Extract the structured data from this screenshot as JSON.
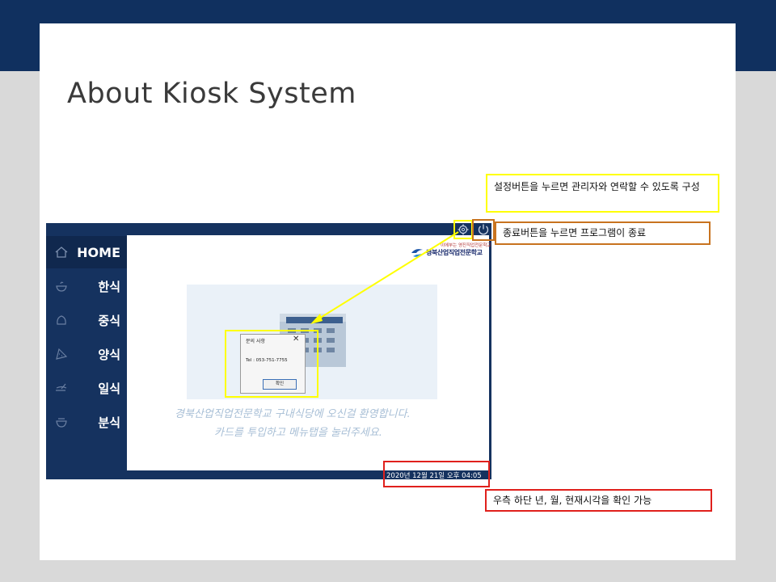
{
  "slide": {
    "title": "About Kiosk System"
  },
  "kiosk": {
    "sidebar": {
      "items": [
        {
          "label": "HOME",
          "icon": "home-icon"
        },
        {
          "label": "한식",
          "icon": "rice-bowl-icon"
        },
        {
          "label": "중식",
          "icon": "dumpling-icon"
        },
        {
          "label": "양식",
          "icon": "pizza-icon"
        },
        {
          "label": "일식",
          "icon": "sushi-icon"
        },
        {
          "label": "분식",
          "icon": "noodle-bowl-icon"
        }
      ]
    },
    "school": {
      "small_text": "이에부는 영진직업전문학교",
      "name": "경북산업직업전문학교"
    },
    "welcome": {
      "line1": "경북산업직업전문학교 구내식당에 오신걸 환영합니다.",
      "line2": "카드를 투입하고 메뉴탭을 눌러주세요."
    },
    "dialog": {
      "title": "문의 사항",
      "message": "Tel : 053-751-7755",
      "ok_label": "확인",
      "close_glyph": "✕"
    },
    "clock": "2020년 12월 21일 오후 04:05"
  },
  "callouts": {
    "settings": "설정버튼을 누르면 관리자와 연락할 수 있도록 구성",
    "exit": "종료버튼을 누르면 프로그램이 종료",
    "clock": "우측 하단 년, 월, 현재시각을 확인 가능"
  },
  "colors": {
    "navy": "#15325f",
    "yellow": "#ffff00",
    "orange": "#c8731f",
    "red": "#e0201c"
  }
}
